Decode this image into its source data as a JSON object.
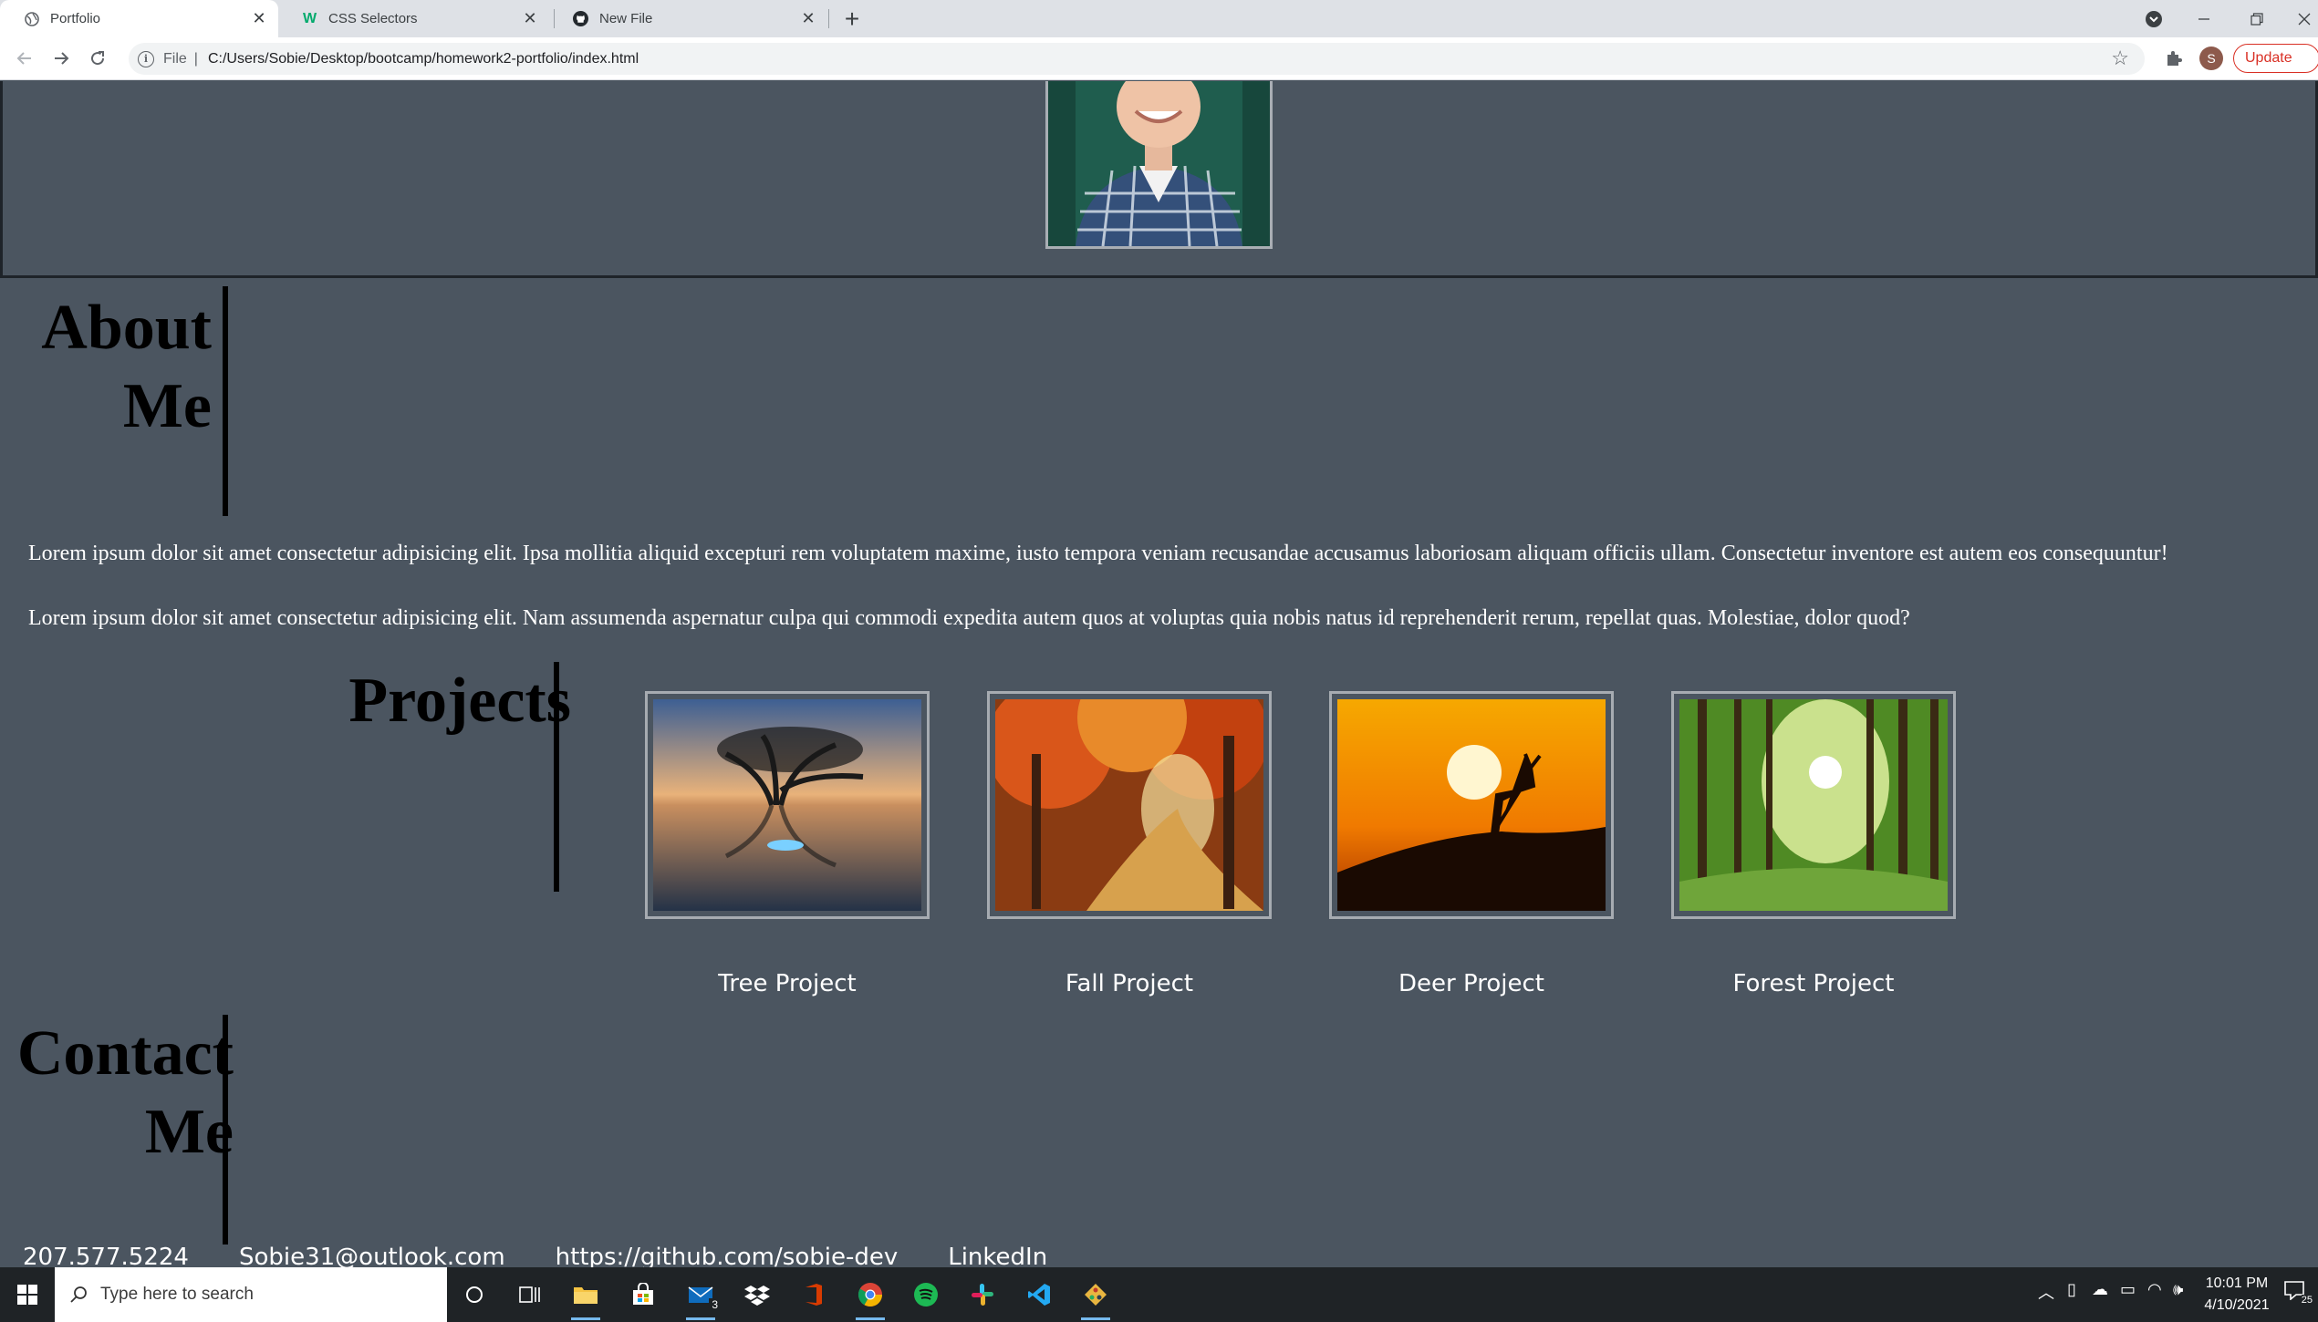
{
  "browser": {
    "tabs": [
      {
        "label": "Portfolio",
        "active": true
      },
      {
        "label": "CSS Selectors",
        "active": false
      },
      {
        "label": "New File",
        "active": false
      }
    ],
    "address": {
      "scheme": "File",
      "url": "C:/Users/Sobie/Desktop/bootcamp/homework2-portfolio/index.html"
    },
    "profile_initial": "S",
    "update_label": "Update"
  },
  "page": {
    "about": {
      "title_line1": "About",
      "title_line2": "Me",
      "paragraph1": "Lorem ipsum dolor sit amet consectetur adipisicing elit. Ipsa mollitia aliquid excepturi rem voluptatem maxime, iusto tempora veniam recusandae accusamus laboriosam aliquam officiis ullam. Consectetur inventore est autem eos consequuntur!",
      "paragraph2": "Lorem ipsum dolor sit amet consectetur adipisicing elit. Nam assumenda aspernatur culpa qui commodi expedita autem quos at voluptas quia nobis natus id reprehenderit rerum, repellat quas. Molestiae, dolor quod?"
    },
    "projects": {
      "title": "Projects",
      "items": [
        {
          "label": "Tree Project",
          "image": "tree-on-lake-image"
        },
        {
          "label": "Fall Project",
          "image": "autumn-path-image"
        },
        {
          "label": "Deer Project",
          "image": "deer-sunset-image"
        },
        {
          "label": "Forest Project",
          "image": "sunlit-forest-image"
        }
      ]
    },
    "contact": {
      "title_line1": "Contact",
      "title_line2": "Me",
      "phone": "207.577.5224",
      "email": "Sobie31@outlook.com",
      "github": "https://github.com/sobie-dev",
      "linkedin": "LinkedIn"
    }
  },
  "taskbar": {
    "search_placeholder": "Type here to search",
    "mail_badge": "3",
    "time": "10:01 PM",
    "date": "4/10/2021",
    "notification_count": "25"
  },
  "colors": {
    "page_bg": "#4b5560",
    "chrome_bg": "#dee1e6",
    "update_red": "#d93025"
  }
}
